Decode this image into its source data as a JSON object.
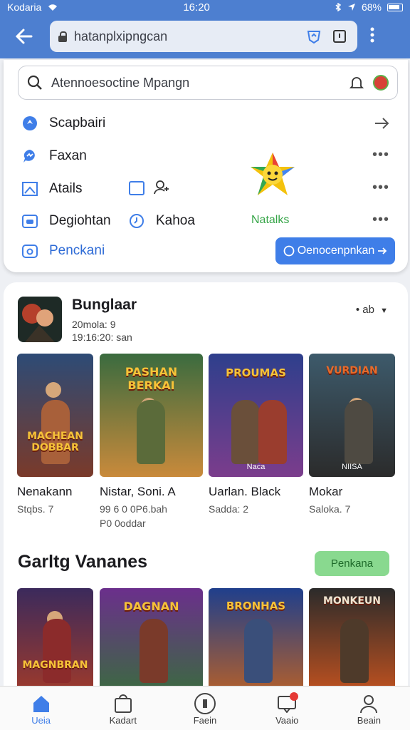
{
  "status_bar": {
    "carrier": "Kodaria",
    "time": "16:20",
    "battery": "68%"
  },
  "browser": {
    "url": "hatanplxipngcan"
  },
  "search": {
    "placeholder": "Atennoesoctine Mpangn"
  },
  "menu": {
    "items": [
      {
        "label": "Scapbairi"
      },
      {
        "label": "Faxan"
      },
      {
        "label": "Atails"
      },
      {
        "label": "Degiohtan"
      },
      {
        "label": "Penckani"
      }
    ],
    "kahoa_label": "Kahoa",
    "brand_label": "Natalks",
    "action_button": "Oenocenpnkan"
  },
  "featured": {
    "title": "Bunglaar",
    "subtitle": "20mola: 9",
    "time": "19:16:20: san",
    "sort_label": "ab"
  },
  "row1": [
    {
      "poster_title": "MACHEAN DOBBAR",
      "poster_sub": "",
      "name": "Nenakann",
      "meta": [
        "Stqbs. 7"
      ]
    },
    {
      "poster_title": "PASHAN BERKAI",
      "poster_sub": "",
      "name": "Nistar, Soni. A",
      "meta": [
        "99 6 0 0P6.bah",
        "P0 0oddar"
      ]
    },
    {
      "poster_title": "PROUMAS",
      "poster_sub": "Naca",
      "name": "Uarlan. Black",
      "meta": [
        "Sadda: 2"
      ]
    },
    {
      "poster_title": "VURDIAN",
      "poster_sub": "NIISA",
      "name": "Mokar",
      "meta": [
        "Saloka. 7"
      ]
    }
  ],
  "section": {
    "title": "Garltg Vananes",
    "button": "Penkana"
  },
  "row2": [
    {
      "poster_title": "MAGNBRAN"
    },
    {
      "poster_title": "DAGNAN"
    },
    {
      "poster_title": "BRONHAS"
    },
    {
      "poster_title": "MONKEUN"
    }
  ],
  "bottom_nav": [
    {
      "label": "Ueia"
    },
    {
      "label": "Kadart"
    },
    {
      "label": "Faein"
    },
    {
      "label": "Vaaio"
    },
    {
      "label": "Beain"
    }
  ],
  "colors": {
    "accent": "#4d7fd0",
    "button": "#3f7ee8",
    "green": "#36a548"
  }
}
